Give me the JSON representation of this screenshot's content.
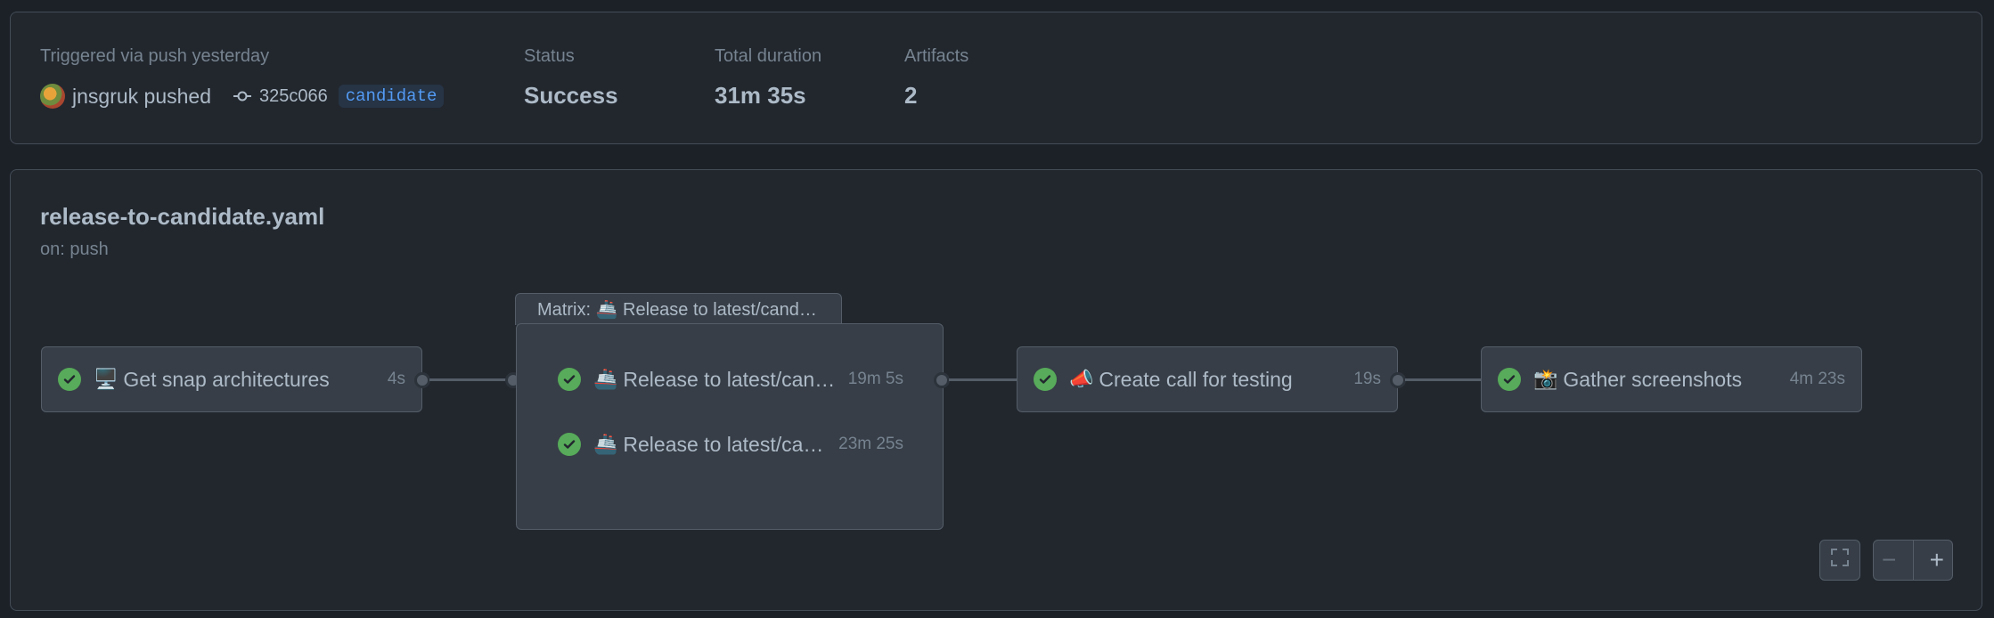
{
  "summary": {
    "trigger_label": "Triggered via push yesterday",
    "actor": "jnsgruk pushed",
    "commit_sha": "325c066",
    "branch": "candidate",
    "status_label": "Status",
    "status_value": "Success",
    "duration_label": "Total duration",
    "duration_value": "31m 35s",
    "artifacts_label": "Artifacts",
    "artifacts_value": "2"
  },
  "workflow": {
    "file": "release-to-candidate.yaml",
    "trigger": "on: push",
    "jobs": [
      {
        "emoji": "🖥️",
        "name": "Get snap architectures",
        "duration": "4s"
      },
      {
        "emoji": "📣",
        "name": "Create call for testing",
        "duration": "19s"
      },
      {
        "emoji": "📸",
        "name": "Gather screenshots",
        "duration": "4m 23s"
      }
    ],
    "matrix": {
      "title": "Matrix: 🚢 Release to latest/cand…",
      "jobs": [
        {
          "emoji": "🚢",
          "name": "Release to latest/can…",
          "duration": "19m 5s"
        },
        {
          "emoji": "🚢",
          "name": "Release to latest/ca…",
          "duration": "23m 25s"
        }
      ]
    }
  },
  "controls": {
    "fullscreen_icon": "fullscreen-icon",
    "zoom_out": "−",
    "zoom_in": "+"
  },
  "colors": {
    "success": "#57ab5a",
    "accent": "#539bf5",
    "background": "#1c2128"
  }
}
